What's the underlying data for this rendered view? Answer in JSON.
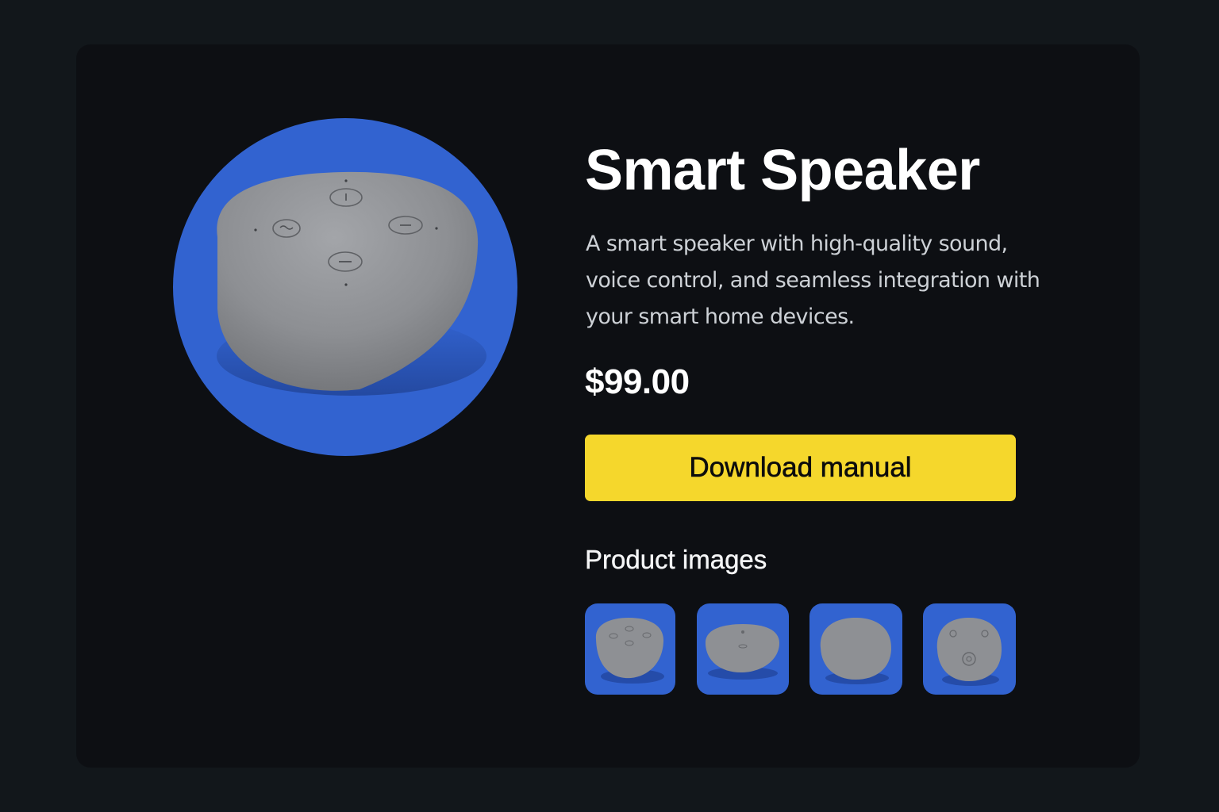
{
  "product": {
    "title": "Smart Speaker",
    "description": "A smart speaker with high-quality sound, voice control, and seamless integration with your smart home devices.",
    "price": "$99.00",
    "hero_image": "smart-speaker-top-view",
    "accent_color": "#3263d0"
  },
  "actions": {
    "download_label": "Download manual",
    "download_color": "#f5d72c"
  },
  "gallery": {
    "heading": "Product images",
    "thumbnails": [
      {
        "image": "speaker-top-view"
      },
      {
        "image": "speaker-side-view"
      },
      {
        "image": "speaker-angled-view"
      },
      {
        "image": "speaker-top-buttons-view"
      }
    ]
  }
}
